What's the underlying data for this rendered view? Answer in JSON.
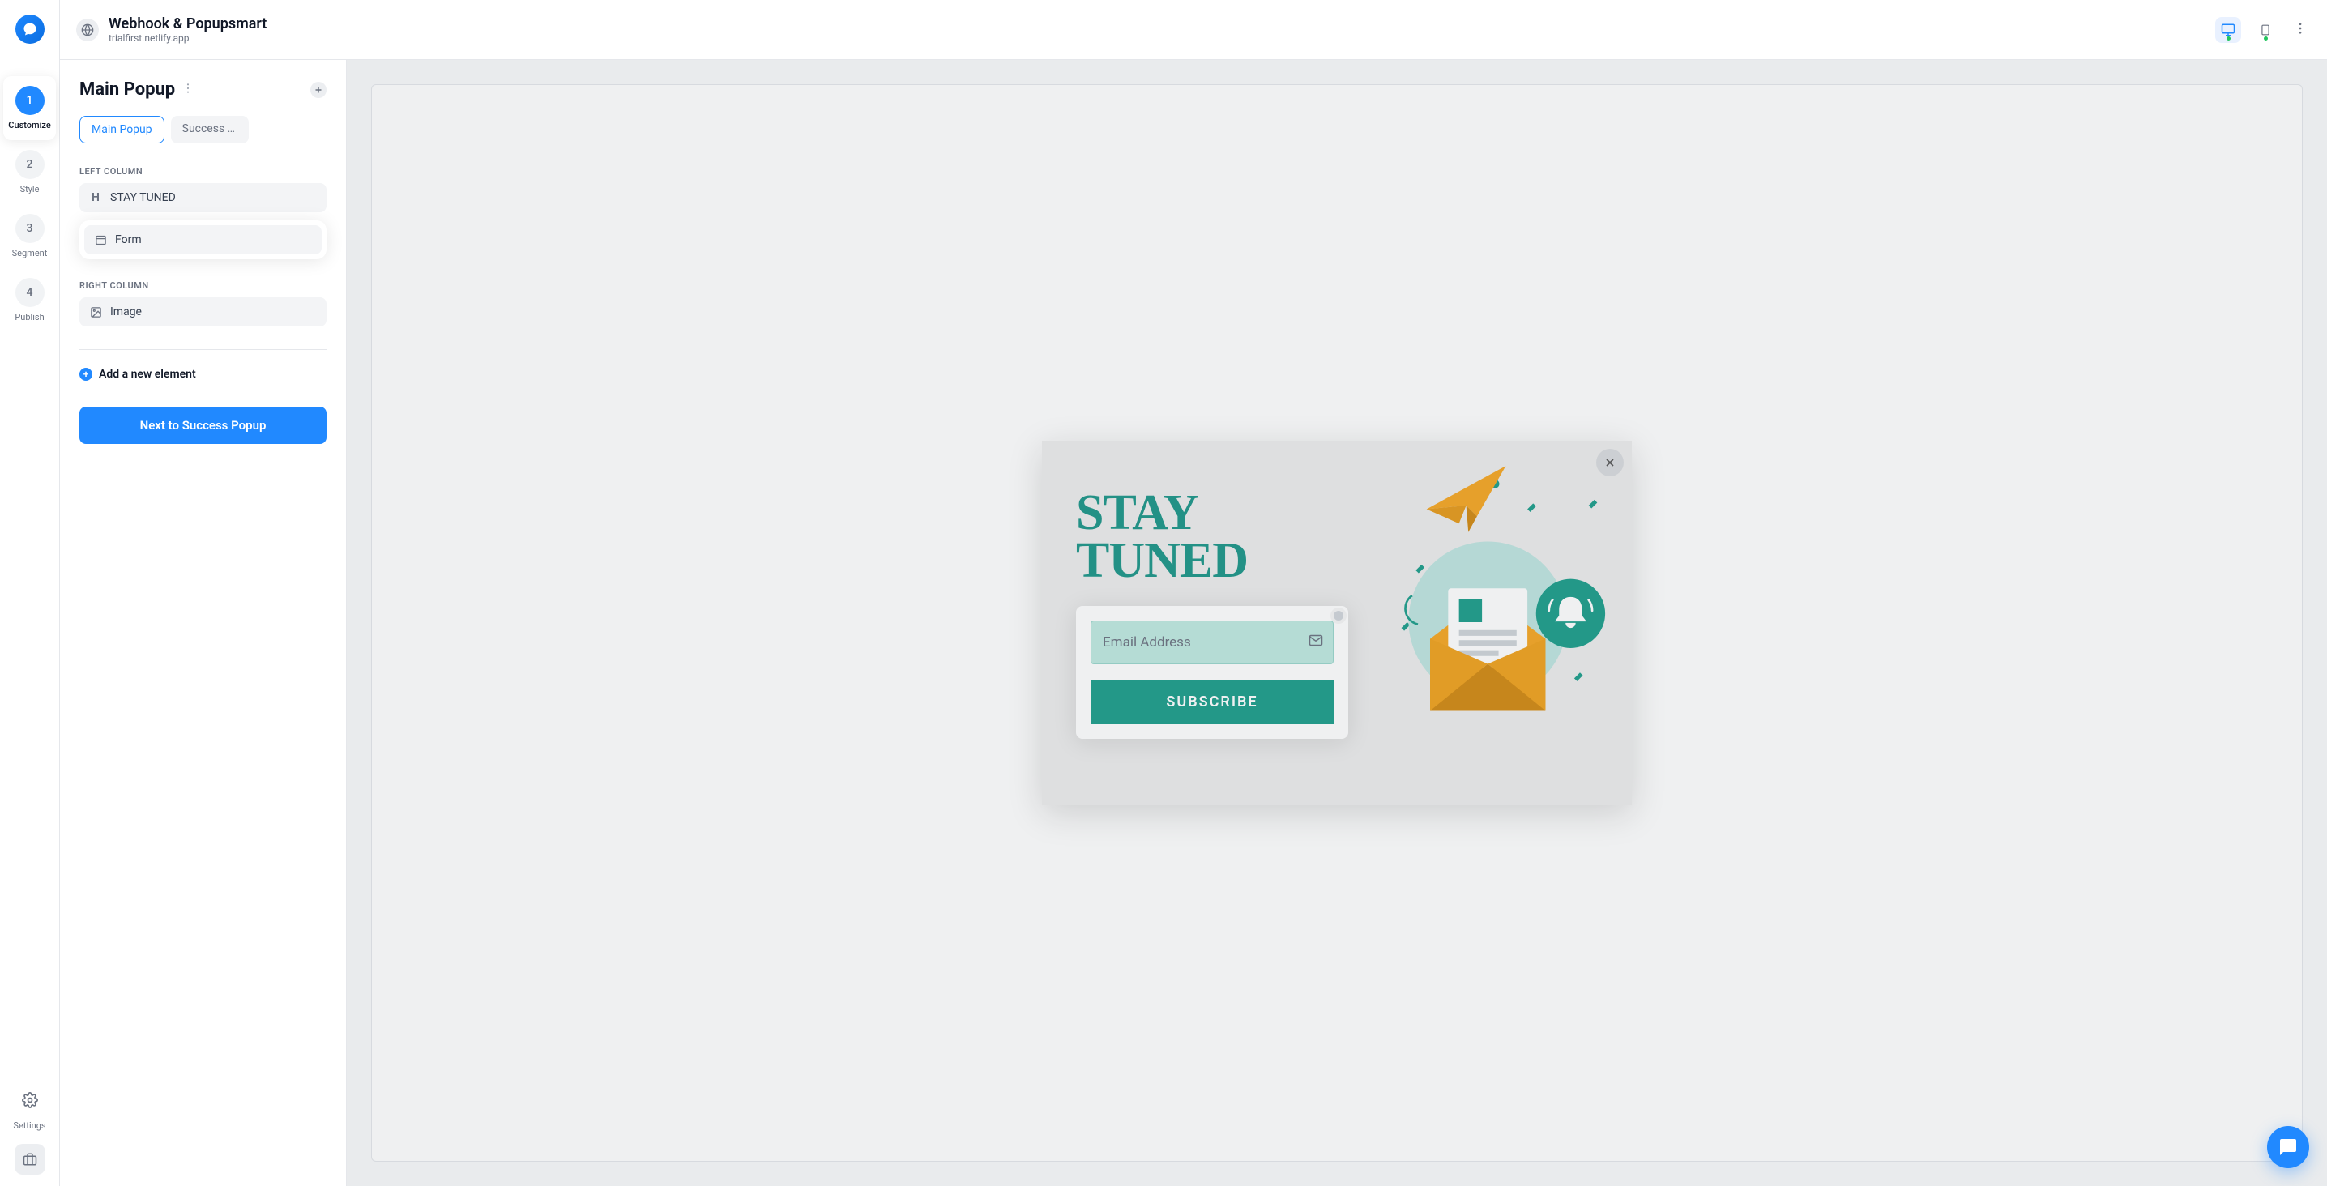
{
  "header": {
    "title": "Webhook & Popupsmart",
    "domain": "trialfirst.netlify.app"
  },
  "steps": [
    {
      "num": "1",
      "label": "Customize",
      "active": true
    },
    {
      "num": "2",
      "label": "Style",
      "active": false
    },
    {
      "num": "3",
      "label": "Segment",
      "active": false
    },
    {
      "num": "4",
      "label": "Publish",
      "active": false
    }
  ],
  "settings_label": "Settings",
  "panel": {
    "title": "Main Popup",
    "tabs": [
      {
        "label": "Main Popup",
        "active": true
      },
      {
        "label": "Success Po…",
        "active": false
      }
    ],
    "left_column_label": "LEFT COLUMN",
    "right_column_label": "RIGHT COLUMN",
    "elements_left": [
      {
        "icon": "H",
        "label": "STAY TUNED",
        "kind": "heading"
      },
      {
        "icon": "form",
        "label": "Form",
        "kind": "form",
        "highlight": true
      }
    ],
    "elements_right": [
      {
        "icon": "image",
        "label": "Image",
        "kind": "image"
      }
    ],
    "add_element": "Add a new element",
    "next_button": "Next to Success Popup"
  },
  "popup": {
    "headline_line1": "STAY",
    "headline_line2": "TUNED",
    "email_placeholder": "Email Address",
    "subscribe_label": "SUBSCRIBE"
  },
  "colors": {
    "accent": "#2189ff",
    "teal": "#1c9e8b"
  }
}
